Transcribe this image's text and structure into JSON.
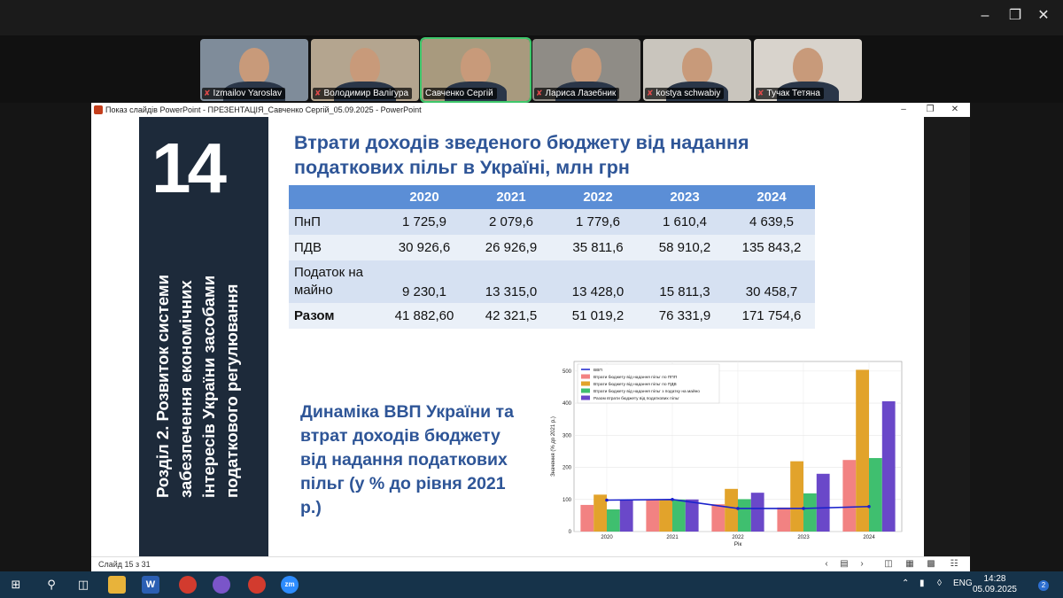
{
  "participants": [
    {
      "name": "Izmailov Yaroslav",
      "muted": true
    },
    {
      "name": "Володимир Валігура",
      "muted": true
    },
    {
      "name": "Савченко Сергій",
      "muted": false
    },
    {
      "name": "Лариса Лазебник",
      "muted": true
    },
    {
      "name": "kostya schwabiy",
      "muted": true
    },
    {
      "name": "Тучак Тетяна",
      "muted": true
    }
  ],
  "ppt_window": {
    "title": "Показ слайдів PowerPoint  -  ПРЕЗЕНТАЦІЯ_Савченко Сергій_05.09.2025 - PowerPoint",
    "status": "Слайд 15 з 31"
  },
  "slide": {
    "number": "14",
    "section_title": "Розділ 2. Розвиток системи забезпечення економічних інтересів України засобами податкового регулювання",
    "title": "Втрати доходів зведеного бюджету від надання податкових пільг в Україні, млн грн",
    "subtitle": "Динаміка ВВП України та втрат доходів бюджету від надання податкових пільг (у % до рівня 2021 р.)"
  },
  "table": {
    "headers": [
      "",
      "2020",
      "2021",
      "2022",
      "2023",
      "2024"
    ],
    "rows": [
      {
        "label": "ПнП",
        "values": [
          "1 725,9",
          "2 079,6",
          "1 779,6",
          "1 610,4",
          "4 639,5"
        ]
      },
      {
        "label": "ПДВ",
        "values": [
          "30 926,6",
          "26 926,9",
          "35 811,6",
          "58 910,2",
          "135 843,2"
        ]
      },
      {
        "label": "Податок на майно",
        "values": [
          "9 230,1",
          "13 315,0",
          "13 428,0",
          "15 811,3",
          "30 458,7"
        ]
      },
      {
        "label": "Разом",
        "values": [
          "41 882,60",
          "42 321,5",
          "51 019,2",
          "76 331,9",
          "171 754,6"
        ]
      }
    ]
  },
  "chart_data": {
    "type": "bar",
    "categories": [
      "2020",
      "2021",
      "2022",
      "2023",
      "2024"
    ],
    "xlabel": "Рік",
    "ylabel": "Значення (% до 2021 р.)",
    "ylim": [
      0,
      530
    ],
    "yticks": [
      0,
      100,
      200,
      300,
      400,
      500
    ],
    "grid": true,
    "legend": "top-left",
    "series": [
      {
        "name": "ВВП",
        "kind": "line",
        "color": "#1a22cc",
        "values": [
          98,
          100,
          72,
          72,
          78
        ]
      },
      {
        "name": "Втрати бюджету від надання пільг по ППП",
        "kind": "bar",
        "color": "#f28282",
        "values": [
          83,
          100,
          85,
          75,
          223
        ]
      },
      {
        "name": "Втрати бюджету від надання пільг по ПДВ",
        "kind": "bar",
        "color": "#e2a32b",
        "values": [
          115,
          100,
          133,
          219,
          504
        ]
      },
      {
        "name": "Втрати бюджету від надання пільг з податку на майно",
        "kind": "bar",
        "color": "#3fbf6f",
        "values": [
          69,
          100,
          101,
          119,
          229
        ]
      },
      {
        "name": "Разом втрати бюджету від податкових пільг",
        "kind": "bar",
        "color": "#6a48c9",
        "values": [
          99,
          100,
          121,
          180,
          406
        ]
      }
    ]
  },
  "taskbar": {
    "lang": "ENG",
    "time": "14:28",
    "date": "05.09.2025",
    "notifications": "2"
  }
}
